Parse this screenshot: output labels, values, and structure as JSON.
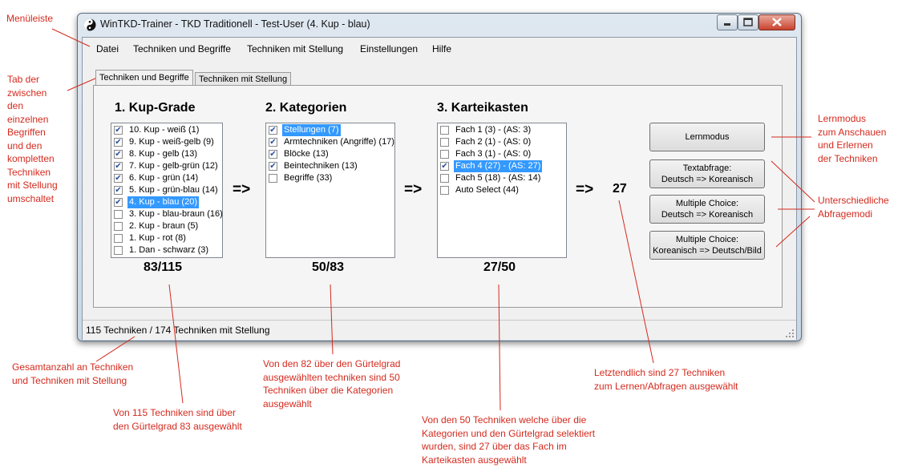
{
  "window": {
    "title": "WinTKD-Trainer - TKD Traditionell - Test-User (4. Kup - blau)"
  },
  "menu": [
    "Datei",
    "Techniken und Begriffe",
    "Techniken mit Stellung",
    "Einstellungen",
    "Hilfe"
  ],
  "tabs": [
    "Techniken und Begriffe",
    "Techniken mit Stellung"
  ],
  "sections": {
    "kup": {
      "heading": "1. Kup-Grade",
      "count": "83/115",
      "items": [
        {
          "label": "10. Kup - weiß (1)",
          "checked": true,
          "selected": false
        },
        {
          "label": "9. Kup - weiß-gelb (9)",
          "checked": true,
          "selected": false
        },
        {
          "label": "8. Kup - gelb (13)",
          "checked": true,
          "selected": false
        },
        {
          "label": "7. Kup - gelb-grün (12)",
          "checked": true,
          "selected": false
        },
        {
          "label": "6. Kup - grün (14)",
          "checked": true,
          "selected": false
        },
        {
          "label": "5. Kup - grün-blau (14)",
          "checked": true,
          "selected": false
        },
        {
          "label": "4. Kup - blau (20)",
          "checked": true,
          "selected": true
        },
        {
          "label": "3. Kup - blau-braun (16)",
          "checked": false,
          "selected": false
        },
        {
          "label": "2. Kup - braun (5)",
          "checked": false,
          "selected": false
        },
        {
          "label": "1. Kup - rot (8)",
          "checked": false,
          "selected": false
        },
        {
          "label": "1. Dan - schwarz (3)",
          "checked": false,
          "selected": false
        }
      ]
    },
    "kategorien": {
      "heading": "2. Kategorien",
      "count": "50/83",
      "items": [
        {
          "label": "Stellungen (7)",
          "checked": true,
          "selected": true
        },
        {
          "label": "Armtechniken (Angriffe) (17)",
          "checked": true,
          "selected": false
        },
        {
          "label": "Blöcke (13)",
          "checked": true,
          "selected": false
        },
        {
          "label": "Beintechniken (13)",
          "checked": true,
          "selected": false
        },
        {
          "label": "Begriffe (33)",
          "checked": false,
          "selected": false
        }
      ]
    },
    "kartei": {
      "heading": "3. Karteikasten",
      "count": "27/50",
      "items": [
        {
          "label": "Fach 1 (3) - (AS: 3)",
          "checked": false,
          "selected": false
        },
        {
          "label": "Fach 2 (1) - (AS: 0)",
          "checked": false,
          "selected": false
        },
        {
          "label": "Fach 3 (1) - (AS: 0)",
          "checked": false,
          "selected": false
        },
        {
          "label": "Fach 4 (27) - (AS: 27)",
          "checked": true,
          "selected": true
        },
        {
          "label": "Fach 5 (18) - (AS: 14)",
          "checked": false,
          "selected": false
        },
        {
          "label": "Auto Select (44)",
          "checked": false,
          "selected": false
        }
      ]
    }
  },
  "arrows": [
    "=>",
    "=>",
    "=>"
  ],
  "result": "27",
  "buttons": {
    "lernmodus": "Lernmodus",
    "textabfrage": [
      "Textabfrage:",
      "Deutsch => Koreanisch"
    ],
    "mc1": [
      "Multiple Choice:",
      "Deutsch => Koreanisch"
    ],
    "mc2": [
      "Multiple Choice:",
      "Koreanisch => Deutsch/Bild"
    ]
  },
  "statusbar": "115 Techniken / 174 Techniken mit Stellung",
  "annotations": {
    "menuleiste": "Menüleiste",
    "tab": "Tab der\nzwischen\nden\neinzelnen\nBegriffen\nund den\nkompletten\nTechniken\nmit Stellung\numschaltet",
    "lernmodus": "Lernmodus\nzum Anschauen\nund Erlernen\nder Techniken",
    "abfragemodi": "Unterschiedliche\nAbfragemodi",
    "gesamt": "Gesamtanzahl an Techniken\nund Techniken mit Stellung",
    "kup": "Von 115 Techniken sind über\nden Gürtelgrad 83 ausgewählt",
    "kategorien": "Von den 82 über den Gürtelgrad\nausgewählten techniken sind 50\nTechniken über die Kategorien\nausgewählt",
    "kartei": "Von den 50 Techniken welche über die\nKategorien und den Gürtelgrad selektiert\nwurden, sind 27 über das Fach im\nKarteikasten ausgewählt",
    "letztendlich": "Letztendlich sind 27 Techniken\nzum Lernen/Abfragen ausgewählt"
  },
  "colors": {
    "annotation": "#d42a1e",
    "selection": "#3399ff"
  }
}
